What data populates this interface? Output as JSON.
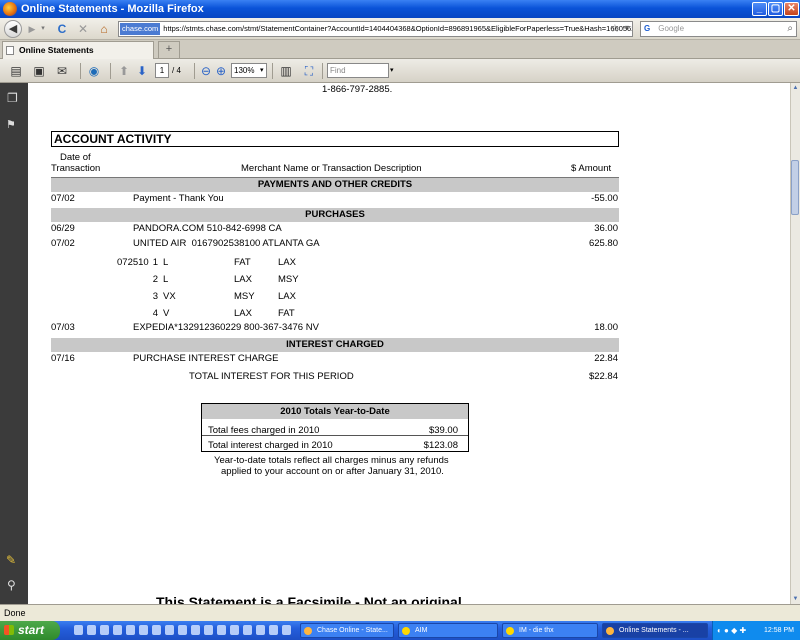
{
  "window": {
    "title": "Online Statements - Mozilla Firefox",
    "min_glyph": "_",
    "max_glyph": "▢",
    "close_glyph": "✕"
  },
  "nav": {
    "back_glyph": "◀",
    "forward_glyph": "▶",
    "reload_glyph": "C",
    "stop_glyph": "✕",
    "home_glyph": "⌂",
    "site_label": "chase.com",
    "url": "https://stmts.chase.com/stmt/StatementContainer?AccountId=1404404368&OptionId=896891965&EligibleForPaperless=True&Hash=166056276",
    "search_placeholder": "Google",
    "search_engine_glyph": "G"
  },
  "tabs": [
    {
      "label": "Online Statements"
    }
  ],
  "new_tab_glyph": "+",
  "pdf_toolbar": {
    "page_current": "1",
    "page_total": "/ 4",
    "zoom": "130%",
    "find_placeholder": "Find"
  },
  "statement": {
    "phone": "1-866-797-2885.",
    "activity_title": "ACCOUNT ACTIVITY",
    "col_date_line1": "Date of",
    "col_date_line2": "Transaction",
    "col_desc": "Merchant Name or Transaction Description",
    "col_amount": "$ Amount",
    "sections": {
      "payments": "PAYMENTS AND OTHER CREDITS",
      "purchases": "PURCHASES",
      "interest": "INTEREST CHARGED"
    },
    "payment": {
      "date": "07/02",
      "desc": "Payment - Thank You",
      "amount": "-55.00"
    },
    "purchase_rows": [
      {
        "date": "06/29",
        "desc": "PANDORA.COM 510-842-6998 CA",
        "amount": "36.00"
      },
      {
        "date": "07/02",
        "desc": "UNITED AIR  0167902538100 ATLANTA GA",
        "amount": "625.80"
      },
      {
        "date": "07/03",
        "desc": "EXPEDIA*132912360229 800-367-3476 NV",
        "amount": "18.00"
      }
    ],
    "flight_code": "072510",
    "flight_legs": [
      {
        "n": "1",
        "cls": "L",
        "from": "FAT",
        "to": "LAX"
      },
      {
        "n": "2",
        "cls": "L",
        "from": "LAX",
        "to": "MSY"
      },
      {
        "n": "3",
        "cls": "VX",
        "from": "MSY",
        "to": "LAX"
      },
      {
        "n": "4",
        "cls": "V",
        "from": "LAX",
        "to": "FAT"
      }
    ],
    "interest_row": {
      "date": "07/16",
      "desc": "PURCHASE INTEREST CHARGE",
      "amount": "22.84"
    },
    "total_interest_label": "TOTAL INTEREST FOR THIS PERIOD",
    "total_interest_amount": "$22.84",
    "ytd": {
      "title": "2010 Totals Year-to-Date",
      "fees_label": "Total fees charged in 2010",
      "fees_amount": "$39.00",
      "interest_label": "Total interest charged in 2010",
      "interest_amount": "$123.08"
    },
    "ytd_note_line1": "Year-to-date totals reflect all charges minus any refunds",
    "ytd_note_line2": "applied to your account on or after January 31, 2010.",
    "facsimile": "This Statement is a Facsimile - Not an original"
  },
  "status": {
    "text": "Done"
  },
  "taskbar": {
    "start": "start",
    "tasks": [
      {
        "label": "Chase Online - State..."
      },
      {
        "label": "AIM"
      },
      {
        "label": "IM - die thx"
      },
      {
        "label": "Online Statements - ..."
      }
    ],
    "clock": "12:58 PM"
  }
}
